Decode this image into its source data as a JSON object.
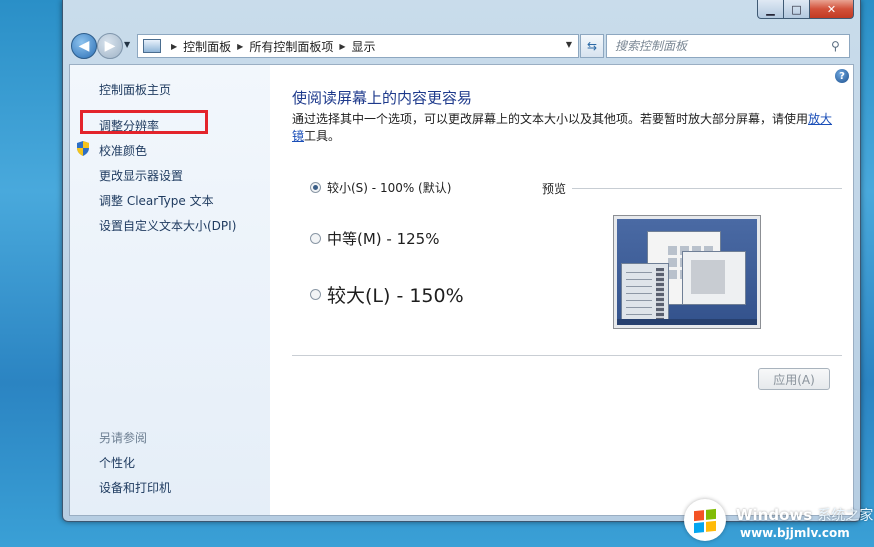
{
  "window": {
    "controls": {
      "minimize": "▁",
      "maximize": "□",
      "close": "✕"
    }
  },
  "address": {
    "breadcrumb": [
      "控制面板",
      "所有控制面板项",
      "显示"
    ],
    "search_placeholder": "搜索控制面板"
  },
  "sidebar": {
    "home": "控制面板主页",
    "items": [
      "调整分辨率",
      "校准颜色",
      "更改显示器设置",
      "调整 ClearType 文本",
      "设置自定义文本大小(DPI)"
    ],
    "see_also_heading": "另请参阅",
    "see_also": [
      "个性化",
      "设备和打印机"
    ]
  },
  "main": {
    "title": "使阅读屏幕上的内容更容易",
    "desc_text": "通过选择其中一个选项，可以更改屏幕上的文本大小以及其他项。若要暂时放大部分屏幕，请使用",
    "desc_link": "放大镜",
    "desc_tail": "工具。",
    "options": [
      {
        "label": "较小(S) - 100% (默认)",
        "selected": true
      },
      {
        "label": "中等(M) - 125%",
        "selected": false
      },
      {
        "label": "较大(L) - 150%",
        "selected": false
      }
    ],
    "preview_label": "预览",
    "apply_button": "应用(A)"
  },
  "watermark": {
    "brand": "Windows",
    "brand_suffix": "系统之家",
    "url": "www.bjjmlv.com",
    "flag_colors": [
      "#f35325",
      "#81bc06",
      "#05a6f0",
      "#ffba08"
    ]
  }
}
